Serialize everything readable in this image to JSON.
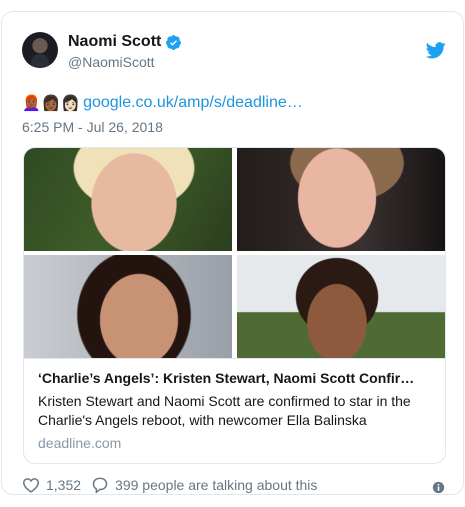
{
  "author": {
    "display_name": "Naomi Scott",
    "handle": "@NaomiScott",
    "verified": true
  },
  "tweet": {
    "emojis": [
      "👩🏾‍🦰",
      "👩🏾",
      "👩🏻"
    ],
    "link_text": "google.co.uk/amp/s/deadline…",
    "timestamp": "6:25 PM - Jul 26, 2018"
  },
  "link_card": {
    "title": "‘Charlie’s Angels’: Kristen Stewart, Naomi Scott Confir…",
    "description": "Kristen Stewart and Naomi Scott are confirmed to star in the Charlie's Angels reboot, with newcomer Ella Balinska",
    "domain": "deadline.com"
  },
  "footer": {
    "likes": "1,352",
    "replies_text": "399 people are talking about this"
  },
  "colors": {
    "link": "#1b95e0",
    "twitter_blue": "#1da1f2",
    "muted": "#657786"
  }
}
